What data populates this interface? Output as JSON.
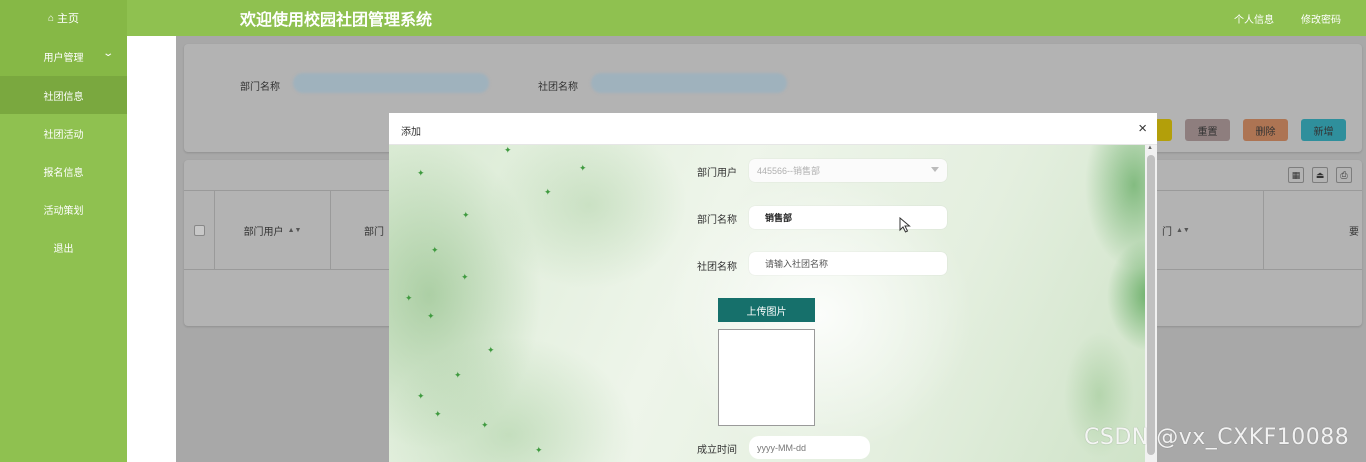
{
  "header": {
    "home_label": "主页",
    "system_title": "欢迎使用校园社团管理系统",
    "profile_link": "个人信息",
    "change_password_link": "修改密码"
  },
  "sidebar": {
    "items": [
      {
        "label": "用户管理",
        "has_submenu": true
      },
      {
        "label": "社团信息",
        "active": true
      },
      {
        "label": "社团活动"
      },
      {
        "label": "报名信息"
      },
      {
        "label": "活动策划"
      },
      {
        "label": "退出"
      }
    ]
  },
  "search": {
    "dept_name_label": "部门名称",
    "club_name_label": "社团名称"
  },
  "actions": {
    "reset_label": "重置",
    "delete_label": "删除",
    "add_label": "新增"
  },
  "table": {
    "headers": [
      "部门用户",
      "部门",
      "门",
      "要"
    ]
  },
  "dialog": {
    "title": "添加",
    "close_glyph": "×",
    "fields": {
      "dept_user_label": "部门用户",
      "dept_user_value": "445566--销售部",
      "dept_name_label": "部门名称",
      "dept_name_value": "销售部",
      "club_name_label": "社团名称",
      "club_name_placeholder": "请输入社团名称",
      "upload_button": "上传图片",
      "founded_label": "成立时间",
      "founded_placeholder": "yyyy-MM-dd"
    }
  },
  "watermark": "CSDN @vx_CXKF10088",
  "colors": {
    "theme_green": "#8fc150",
    "upload_teal": "#16706b"
  }
}
